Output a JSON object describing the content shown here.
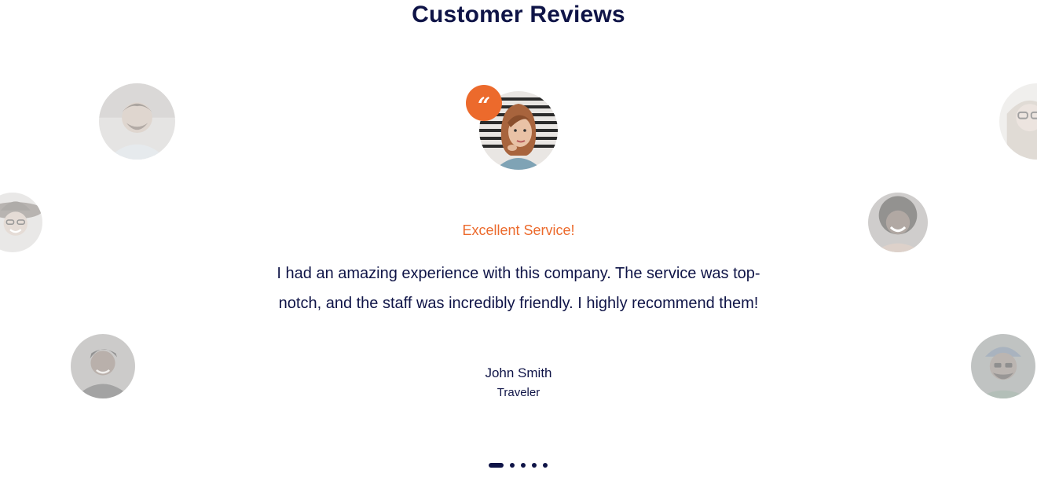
{
  "section": {
    "title": "Customer Reviews"
  },
  "review": {
    "heading": "Excellent Service!",
    "text": "I had an amazing experience with this company. The service was top-notch, and the staff was incredibly friendly. I highly recommend them!",
    "author": "John Smith",
    "role": "Traveler",
    "quote_glyph": "“"
  },
  "pagination": {
    "total": 5,
    "active_index": 0
  },
  "colors": {
    "accent": "#ec6a2c",
    "text": "#0f1447",
    "background": "#ffffff"
  },
  "icons": {
    "quote": "quote-icon"
  }
}
